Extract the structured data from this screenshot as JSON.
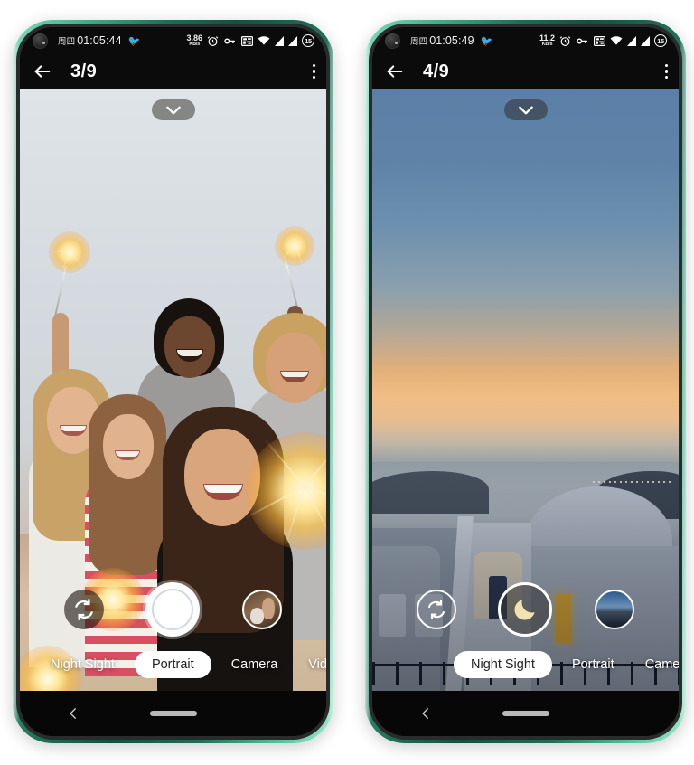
{
  "background_color": "#ffffff",
  "phones": [
    {
      "id": "phone-left",
      "frame_color": "#2e9e7c",
      "statusbar": {
        "day": "周四",
        "time": "01:05:44",
        "bird_icon": "bird-icon",
        "net_speed_value": "3.86",
        "net_speed_unit": "KB/s",
        "icons": [
          "alarm-icon",
          "vpn-key-icon",
          "wifi-calling-icon",
          "wifi-icon",
          "signal-icon",
          "signal-icon"
        ],
        "battery_level": "15"
      },
      "titlebar": {
        "back_icon": "back-arrow-icon",
        "page_count": "3/9",
        "menu_icon": "overflow-menu-icon"
      },
      "viewfinder": {
        "chevron_icon": "chevron-down-icon",
        "scene": "group-selfie-sparklers"
      },
      "controls": {
        "flip_icon": "camera-flip-icon",
        "shutter_icon": "shutter-button",
        "thumbnail": "photo-thumbnail-woman-dog"
      },
      "modes": [
        {
          "label": "Night Sight",
          "active": false
        },
        {
          "label": "Portrait",
          "active": true
        },
        {
          "label": "Camera",
          "active": false
        },
        {
          "label": "Video",
          "active": false
        }
      ],
      "navbar": {
        "back_icon": "nav-back-icon",
        "home_pill": "home-indicator"
      }
    },
    {
      "id": "phone-right",
      "frame_color": "#2e9e7c",
      "statusbar": {
        "day": "周四",
        "time": "01:05:49",
        "bird_icon": "bird-icon",
        "net_speed_value": "11.2",
        "net_speed_unit": "KB/s",
        "icons": [
          "alarm-icon",
          "vpn-key-icon",
          "wifi-calling-icon",
          "wifi-icon",
          "signal-icon",
          "signal-icon"
        ],
        "battery_level": "15"
      },
      "titlebar": {
        "back_icon": "back-arrow-icon",
        "page_count": "4/9",
        "menu_icon": "overflow-menu-icon"
      },
      "viewfinder": {
        "chevron_icon": "chevron-down-icon",
        "scene": "santorini-dusk-seascape"
      },
      "controls": {
        "flip_icon": "camera-flip-icon",
        "shutter_icon": "moon-icon",
        "thumbnail": "photo-thumbnail-landscape"
      },
      "modes": [
        {
          "label": "Night Sight",
          "active": true
        },
        {
          "label": "Portrait",
          "active": false
        },
        {
          "label": "Camera",
          "active": false
        }
      ],
      "navbar": {
        "back_icon": "nav-back-icon",
        "home_pill": "home-indicator"
      }
    }
  ]
}
